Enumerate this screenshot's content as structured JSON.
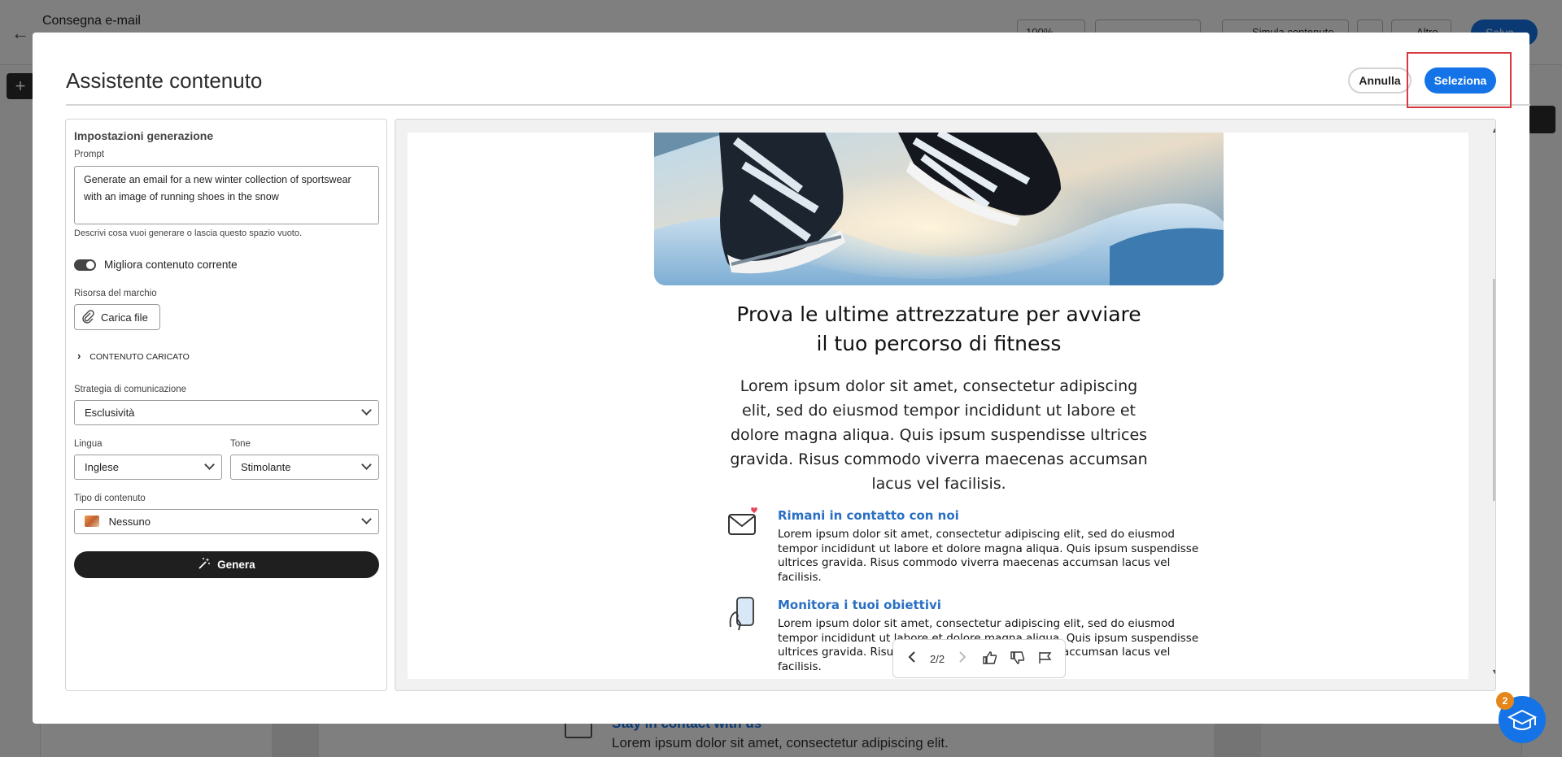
{
  "background": {
    "page_title": "Consegna e-mail",
    "zoom": "100%",
    "simulate_label": "Simula contenuto",
    "more_label": "Altro",
    "save_label": "Salva",
    "bottom_feature_title": "Stay in contact with us",
    "bottom_feature_text": "Lorem ipsum dolor sit amet, consectetur adipiscing elit."
  },
  "modal": {
    "title": "Assistente contenuto",
    "cancel_label": "Annulla",
    "select_label": "Seleziona"
  },
  "settings": {
    "heading": "Impostazioni generazione",
    "prompt_label": "Prompt",
    "prompt_value": "Generate an email for a new winter collection of sportswear with an image of running shoes in the snow",
    "prompt_help": "Descrivi cosa vuoi generare o lascia questo spazio vuoto.",
    "improve_toggle_label": "Migliora contenuto corrente",
    "improve_toggle_on": true,
    "brand_asset_label": "Risorsa del marchio",
    "upload_label": "Carica file",
    "uploaded_content_label": "CONTENUTO CARICATO",
    "strategy_label": "Strategia di comunicazione",
    "strategy_value": "Esclusività",
    "language_label": "Lingua",
    "language_value": "Inglese",
    "tone_label": "Tone",
    "tone_value": "Stimolante",
    "content_type_label": "Tipo di contenuto",
    "content_type_value": "Nessuno",
    "generate_label": "Genera"
  },
  "preview": {
    "headline": "Prova le ultime attrezzature per avviare il tuo percorso di fitness",
    "body": "Lorem ipsum dolor sit amet, consectetur adipiscing elit, sed do eiusmod tempor incididunt ut labore et dolore magna aliqua. Quis ipsum suspendisse ultrices gravida. Risus commodo viverra maecenas accumsan lacus vel facilisis.",
    "features": [
      {
        "title": "Rimani in contatto con noi",
        "text": "Lorem ipsum dolor sit amet, consectetur adipiscing elit, sed do eiusmod tempor incididunt ut labore et dolore magna aliqua. Quis ipsum suspendisse ultrices gravida. Risus commodo viverra maecenas accumsan lacus vel facilisis.",
        "icon": "mail-heart-icon"
      },
      {
        "title": "Monitora i tuoi obiettivi",
        "text": "Lorem ipsum dolor sit amet, consectetur adipiscing elit, sed do eiusmod tempor incididunt ut labore et dolore magna aliqua. Quis ipsum suspendisse ultrices gravida. Risus commodo viverra maecenas accumsan lacus vel facilisis.",
        "icon": "hand-phone-icon"
      }
    ],
    "pager": "2/2"
  },
  "help": {
    "badge_count": "2"
  },
  "colors": {
    "accent": "#1473e6",
    "highlight": "#d7373f",
    "feature_title": "#2a6fc4",
    "generate_button": "#1f1f1f"
  }
}
